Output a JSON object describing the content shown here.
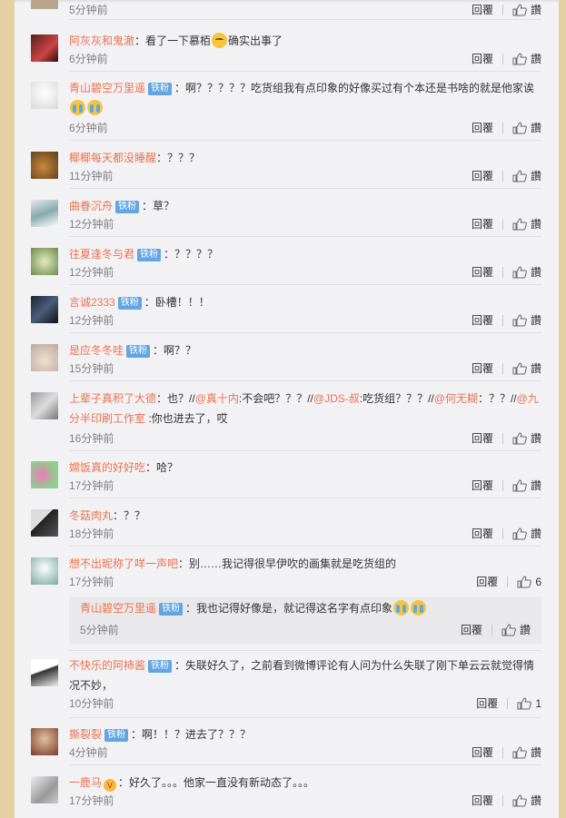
{
  "ui": {
    "reply_label": "回覆",
    "like_label": "讚"
  },
  "comments": [
    {
      "time": "5分钟前",
      "like": "讚"
    },
    {
      "user": "阿灰灰和鬼澈",
      "pre": "：看了一下慕栢",
      "post": "确实出事了",
      "time": "6分钟前",
      "like": "讚"
    },
    {
      "user": "青山碧空万里遥",
      "badge": "铁粉",
      "line1": "：啊？？？？？吃货组我有点印象的好像买过有个本还是书啥的就是他家诶",
      "time": "6分钟前",
      "like": "讚"
    },
    {
      "user": "椰椰每天都没睡醒",
      "text": "：？？？",
      "time": "11分钟前",
      "like": "讚"
    },
    {
      "user": "曲眷沉舟",
      "badge": "铁粉",
      "text": "：草？",
      "time": "12分钟前",
      "like": "讚"
    },
    {
      "user": "往夏逢冬与君",
      "badge": "铁粉",
      "text": "：？？？？",
      "time": "12分钟前",
      "like": "讚"
    },
    {
      "user": "言诚2333",
      "badge": "铁粉",
      "text": "：卧槽！！！",
      "time": "12分钟前",
      "like": "讚"
    },
    {
      "user": "是应冬冬哇",
      "badge": "铁粉",
      "text": "：啊？？",
      "time": "15分钟前",
      "like": "讚"
    },
    {
      "user": "上辈子真积了大德",
      "t1": "：也？//",
      "m1": "@真十内",
      "t2": ":不会吧？？？//",
      "m2": "@JDS-叔",
      "t3": ":吃货组？？？//",
      "m3": "@何无糊",
      "t4": "：？？//",
      "m4": "@九",
      "m4b": "分半印刷工作室",
      "t5": " :你也进去了，哎",
      "time": "16分钟前",
      "like": "讚"
    },
    {
      "user": "嫦饭真的好好吃",
      "text": "：哈？",
      "time": "17分钟前",
      "like": "讚"
    },
    {
      "user": "冬菇肉丸",
      "text": "：？？",
      "time": "18分钟前",
      "like": "讚"
    },
    {
      "user": "想不出昵称了咩一声吧",
      "text": "：别……我记得很早伊吹的画集就是吃货组的",
      "time": "17分钟前",
      "like": "6"
    },
    {
      "user": "不快乐的阿柿酱",
      "badge": "铁粉",
      "line1": "：失联好久了，之前看到微博评论有人问为什么失联了刚下单云云就觉得情",
      "line2": "况不妙，",
      "time": "10分钟前",
      "like": "1"
    },
    {
      "user": "撕裂裂",
      "badge": "铁粉",
      "text": "：啊！！？进去了？？？",
      "time": "4分钟前",
      "like": "讚"
    },
    {
      "user": "一鹿马",
      "vip": "V",
      "text": "：好久了。。。他家一直没有新动态了。。。",
      "time": "17分钟前",
      "like": "讚"
    }
  ],
  "subreply": {
    "user": "青山碧空万里遥",
    "badge": "铁粉",
    "text": "：我也记得好像是，就记得这名字有点印象",
    "time": "5分钟前",
    "like": "讚"
  },
  "colors": {
    "username": "#eb7350",
    "badge": "#62a5e1",
    "background": "#f2f2f5",
    "page": "#e5d0a4"
  }
}
